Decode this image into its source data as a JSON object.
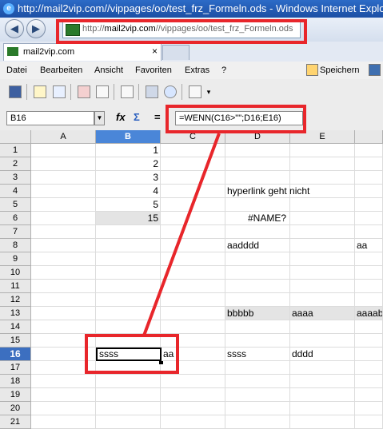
{
  "browser": {
    "title": "http://mail2vip.com//vippages/oo/test_frz_Formeln.ods - Windows Internet Explorer",
    "address_prefix": "http://",
    "address_domain": "mail2vip.com",
    "address_path": "//vippages/oo/test_frz_Formeln.ods",
    "tab_label": "mail2vip.com",
    "tab_close": "×",
    "back_arrow": "◀",
    "forward_arrow": "▶"
  },
  "menu": {
    "items": [
      "Datei",
      "Bearbeiten",
      "Ansicht",
      "Favoriten",
      "Extras",
      "?"
    ],
    "save_label": "Speichern"
  },
  "formula_bar": {
    "cell_ref": "B16",
    "formula": "=WENN(C16>\"\";D16;E16)",
    "fx": "fx",
    "sum": "Σ",
    "equals": "="
  },
  "sheet": {
    "columns": [
      "A",
      "B",
      "C",
      "D",
      "E"
    ],
    "selected_column": "B",
    "rows": [
      "1",
      "2",
      "3",
      "4",
      "5",
      "6",
      "7",
      "8",
      "9",
      "10",
      "11",
      "12",
      "13",
      "14",
      "15",
      "16",
      "17",
      "18",
      "19",
      "20",
      "21"
    ],
    "selected_row": "16",
    "cells": {
      "B1": "1",
      "B2": "2",
      "B3": "3",
      "B4": "4",
      "B5": "5",
      "B6": "15",
      "D4": "hyperlink geht nicht",
      "D6": "#NAME?",
      "D8": "aadddd",
      "F8": "aa",
      "D13": "bbbbb",
      "E13": "aaaa",
      "F13": "aaaab",
      "B16": "ssss",
      "C16": "aa",
      "D16": "ssss",
      "E16": "dddd"
    }
  },
  "colors": {
    "annotation_red": "#e8262b",
    "selection_blue": "#4a86d8"
  }
}
